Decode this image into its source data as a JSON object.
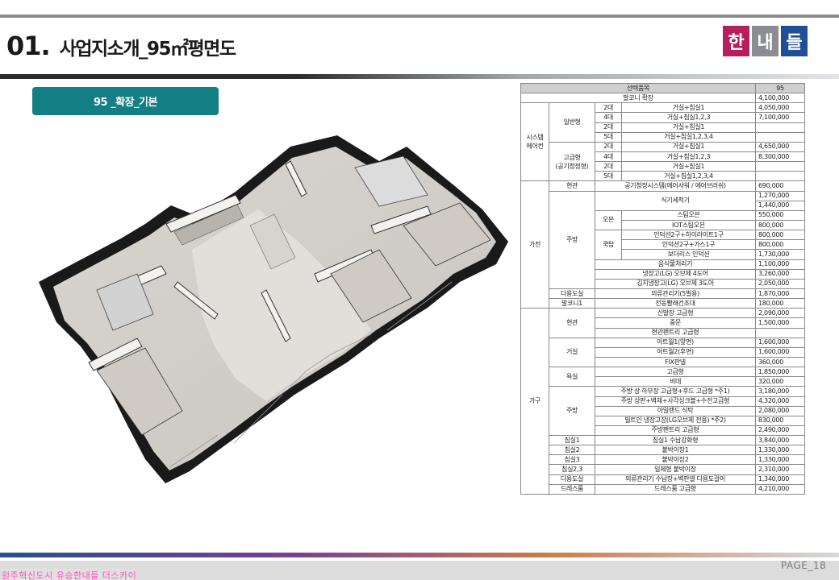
{
  "header": {
    "title_num": "01.",
    "title_text": "사업지소개_95㎡평면도",
    "logo": [
      "한",
      "내",
      "들"
    ],
    "colors": {
      "logo1": "#b51f5c",
      "logo2": "#8a8e93",
      "logo3": "#1f4f96",
      "tag": "#137f85"
    }
  },
  "tag_label": "95 _확장_기본",
  "floorplan": {
    "icon": "floorplan-illustration"
  },
  "price_table": {
    "head": {
      "item": "선택품목",
      "type": "95"
    },
    "rows": [
      {
        "cells": [
          "발코니 확장"
        ],
        "price": "4,100,000"
      },
      {
        "cells": [
          "2대",
          "거실+침실1"
        ],
        "price": "4,050,000"
      },
      {
        "cells": [
          "4대",
          "거실+침실1,2,3"
        ],
        "price": "7,100,000"
      },
      {
        "cells": [
          "2대",
          "거실+침실1"
        ],
        "price": ""
      },
      {
        "cells": [
          "5대",
          "거실+침실1,2,3,4"
        ],
        "price": ""
      },
      {
        "cells": [
          "2대",
          "거실+침실1"
        ],
        "price": "4,650,000"
      },
      {
        "cells": [
          "4대",
          "거실+침실1,2,3"
        ],
        "price": "8,300,000"
      },
      {
        "cells": [
          "2대",
          "거실+침실1"
        ],
        "price": ""
      },
      {
        "cells": [
          "5대",
          "거실+침실1,2,3,4"
        ],
        "price": ""
      },
      {
        "cells": [
          "현관",
          "공기청정시스템(에어샤워 / 에어브러쉬)"
        ],
        "price": "690,000"
      },
      {
        "cells": [
          "식기세척기"
        ],
        "price": "1,270,000"
      },
      {
        "cells": [],
        "price": "1,440,000"
      },
      {
        "cells": [
          "오븐",
          "스팀오븐"
        ],
        "price": "550,000"
      },
      {
        "cells": [
          "IOT스팀오븐"
        ],
        "price": "800,000"
      },
      {
        "cells": [
          "쿡탑",
          "인덕션2구+하이라이트1구"
        ],
        "price": "800,000"
      },
      {
        "cells": [
          "인덕션2구+가스1구"
        ],
        "price": "800,000"
      },
      {
        "cells": [
          "보더리스 인덕션"
        ],
        "price": "1,730,000"
      },
      {
        "cells": [
          "음식물처리기"
        ],
        "price": "1,100,000"
      },
      {
        "cells": [
          "냉장고(LG) 오브제 4도어"
        ],
        "price": "3,260,000"
      },
      {
        "cells": [
          "김치냉장고(LG) 오브제 3도어"
        ],
        "price": "2,050,000"
      },
      {
        "cells": [
          "다용도실",
          "의류관리기(5벌용)"
        ],
        "price": "1,870,000"
      },
      {
        "cells": [
          "발코니1",
          "전동빨래건조대"
        ],
        "price": "180,000"
      },
      {
        "cells": [
          "신발장 고급형"
        ],
        "price": "2,090,000"
      },
      {
        "cells": [
          "중문"
        ],
        "price": "1,500,000"
      },
      {
        "cells": [
          "현관팬트리 고급형"
        ],
        "price": ""
      },
      {
        "cells": [
          "아트월1(앞면)"
        ],
        "price": "1,600,000"
      },
      {
        "cells": [
          "아트월2(후면)"
        ],
        "price": "1,600,000"
      },
      {
        "cells": [
          "FIX판넬"
        ],
        "price": "360,000"
      },
      {
        "cells": [
          "고급형"
        ],
        "price": "1,850,000"
      },
      {
        "cells": [
          "비데"
        ],
        "price": "320,000"
      },
      {
        "cells": [
          "주방 상·하부장 고급형+후드 고급형 *주1)"
        ],
        "price": "3,180,000"
      },
      {
        "cells": [
          "주방 상판+벽체+사각싱크볼+수전고급형"
        ],
        "price": "4,320,000"
      },
      {
        "cells": [
          "아일랜드 식탁"
        ],
        "price": "2,080,000"
      },
      {
        "cells": [
          "빌트인 냉장고장(LG오브제 전용) *주2)"
        ],
        "price": "830,000"
      },
      {
        "cells": [
          "주방팬트리 고급형"
        ],
        "price": "2,490,000"
      },
      {
        "cells": [
          "침실1",
          "침실1 수납강화형"
        ],
        "price": "3,840,000"
      },
      {
        "cells": [
          "침실2",
          "붙박이장1"
        ],
        "price": "1,330,000"
      },
      {
        "cells": [
          "침실3",
          "붙박이장2"
        ],
        "price": "1,330,000"
      },
      {
        "cells": [
          "침실2,3",
          "일체형 붙박이장"
        ],
        "price": "2,310,000"
      },
      {
        "cells": [
          "다용도실",
          "의류관리기 수납장+벽판넬 다용도걸이"
        ],
        "price": "1,340,000"
      },
      {
        "cells": [
          "드레스룸",
          "드레스룸 고급형"
        ],
        "price": "4,210,000"
      }
    ],
    "groups": {
      "aircon": "시스템\n에어컨",
      "general": "일반형",
      "premium": "고급형\n(공기청정형)",
      "appliance": "가전",
      "kitchen": "주방",
      "furniture": "가구",
      "entrance": "현관",
      "living": "거실",
      "bath": "욕실",
      "kitchen2": "주방"
    }
  },
  "footer": {
    "page": "PAGE_18",
    "note": "원주혁신도시 유승한내들 더스카이"
  }
}
